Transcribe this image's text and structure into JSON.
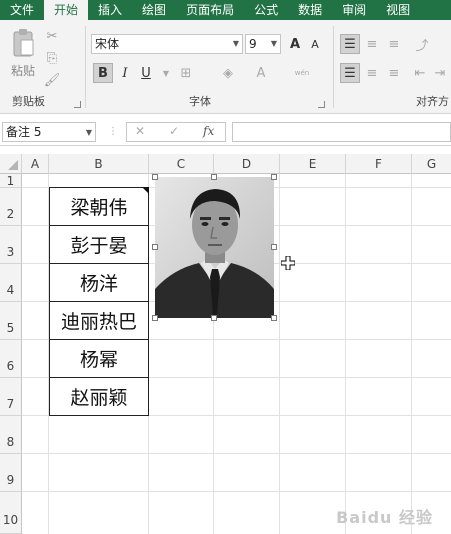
{
  "tabs": [
    "文件",
    "开始",
    "插入",
    "绘图",
    "页面布局",
    "公式",
    "数据",
    "审阅",
    "视图"
  ],
  "clipboard": {
    "paste_label": "粘贴",
    "group_label": "剪贴板"
  },
  "font": {
    "name": "宋体",
    "size": "9",
    "grow": "A",
    "shrink": "A",
    "bold": "B",
    "italic": "I",
    "underline": "U",
    "font_color": "A",
    "phonetic": "wén",
    "group_label": "字体"
  },
  "align": {
    "group_label": "对齐方"
  },
  "formula_bar": {
    "name_box": "备注 5",
    "fx": "fx",
    "cancel": "✕",
    "confirm": "✓",
    "value": ""
  },
  "columns": [
    "A",
    "B",
    "C",
    "D",
    "E",
    "F",
    "G"
  ],
  "rows": [
    "1",
    "2",
    "3",
    "4",
    "5",
    "6",
    "7",
    "8",
    "9",
    "10"
  ],
  "names": [
    "梁朝伟",
    "彭于晏",
    "杨洋",
    "迪丽热巴",
    "杨幂",
    "赵丽颖"
  ],
  "watermark": "Baidu 经验"
}
